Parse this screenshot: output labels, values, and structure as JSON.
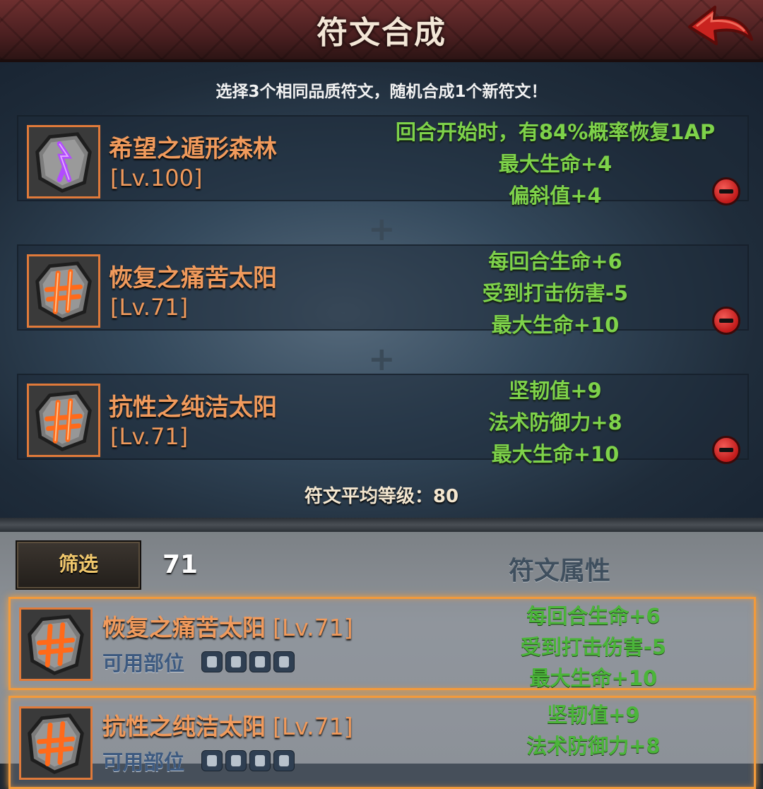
{
  "header": {
    "title": "符文合成",
    "back_icon": "back-arrow-icon"
  },
  "synth": {
    "hint": "选择3个相同品质符文，随机合成1个新符文！",
    "slots": [
      {
        "name": "希望之遁形森林",
        "level": "[Lv.100]",
        "icon": "purple-rune-icon",
        "stats": [
          "回合开始时，有84%概率恢复1AP",
          "最大生命+4",
          "偏斜值+4"
        ]
      },
      {
        "name": "恢复之痛苦太阳",
        "level": "[Lv.71]",
        "icon": "orange-rune-icon",
        "stats": [
          "每回合生命+6",
          "受到打击伤害-5",
          "最大生命+10"
        ]
      },
      {
        "name": "抗性之纯洁太阳",
        "level": "[Lv.71]",
        "icon": "orange-rune-icon",
        "stats": [
          "坚韧值+9",
          "法术防御力+8",
          "最大生命+10"
        ]
      }
    ],
    "avg_level": "符文平均等级：80"
  },
  "list": {
    "filter_label": "筛选",
    "filter_value": "71",
    "attr_header": "符文属性",
    "items": [
      {
        "name": "恢复之痛苦太阳",
        "level": "[Lv.71]",
        "avail_label": "可用部位",
        "stats": [
          "每回合生命+6",
          "受到打击伤害-5",
          "最大生命+10"
        ]
      },
      {
        "name": "抗性之纯洁太阳",
        "level": "[Lv.71]",
        "avail_label": "可用部位",
        "stats": [
          "坚韧值+9",
          "法术防御力+8"
        ]
      }
    ]
  },
  "colors": {
    "rune_name": "#f09a5c",
    "stat_green": "#7ed24a",
    "frame_orange": "#e07a3a"
  }
}
